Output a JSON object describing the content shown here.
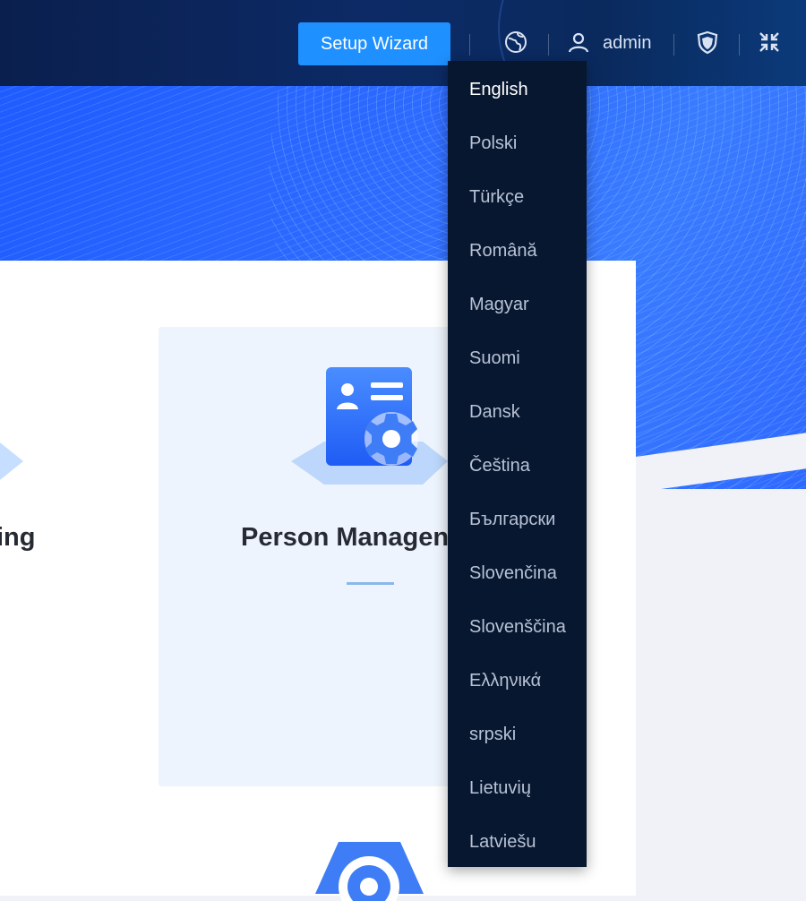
{
  "header": {
    "setup_wizard_label": "Setup Wizard",
    "user_label": "admin",
    "icons": [
      "globe-icon",
      "user-icon",
      "shield-icon",
      "collapse-icon"
    ]
  },
  "main": {
    "left_card_title_fragment": "ing",
    "card_title": "Person Managen"
  },
  "language_menu": {
    "selected": "English",
    "items": [
      "English",
      "Polski",
      "Türkçe",
      "Română",
      "Magyar",
      "Suomi",
      "Dansk",
      "Čeština",
      "Български",
      "Slovenčina",
      "Slovenščina",
      "Ελληνικά",
      "srpski",
      "Lietuvių",
      "Latviešu"
    ]
  },
  "colors": {
    "accent": "#1e90ff",
    "header_bg": "#0a1f4d",
    "menu_bg": "#071730",
    "banner": "#2f6bff"
  }
}
